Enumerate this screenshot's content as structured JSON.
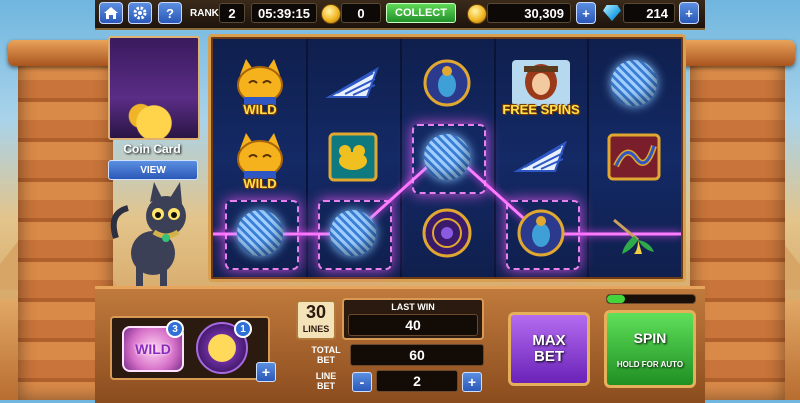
{
  "topbar": {
    "rank_label": "RANK",
    "rank_value": "2",
    "timer": "05:39:15",
    "collect_coins": "0",
    "collect_label": "COLLECT",
    "coin_balance": "30,309",
    "gem_balance": "214",
    "home_icon": "home-icon",
    "settings_icon": "gear-icon",
    "help_label": "?",
    "add_label": "+"
  },
  "coin_card": {
    "title": "Coin Card",
    "view_label": "VIEW"
  },
  "reels": {
    "rows": [
      [
        {
          "sym": "cat",
          "label": "WILD"
        },
        {
          "sym": "pyramid",
          "label": ""
        },
        {
          "sym": "scarab",
          "label": ""
        },
        {
          "sym": "explorer",
          "label": "FREE SPINS"
        },
        {
          "sym": "yarn",
          "label": ""
        }
      ],
      [
        {
          "sym": "cat",
          "label": "WILD"
        },
        {
          "sym": "mouse",
          "label": ""
        },
        {
          "sym": "yarn",
          "label": ""
        },
        {
          "sym": "pyramid",
          "label": ""
        },
        {
          "sym": "snake",
          "label": ""
        }
      ],
      [
        {
          "sym": "yarn",
          "label": ""
        },
        {
          "sym": "yarn",
          "label": ""
        },
        {
          "sym": "amulet",
          "label": ""
        },
        {
          "sym": "scarab",
          "label": ""
        },
        {
          "sym": "lotus",
          "label": ""
        }
      ]
    ]
  },
  "boosters": {
    "wild_label": "WILD",
    "wild_count": "3",
    "coins_count": "1",
    "add_label": "+"
  },
  "bet": {
    "lines_value": "30",
    "lines_label": "LINES",
    "last_win_label": "LAST WIN",
    "last_win_value": "40",
    "total_bet_label": "TOTAL\nBET",
    "total_bet_value": "60",
    "line_bet_label": "LINE\nBET",
    "line_bet_value": "2",
    "minus_label": "-",
    "plus_label": "+"
  },
  "buttons": {
    "max_bet_label": "MAX\nBET",
    "spin_label": "SPIN",
    "spin_sub": "HOLD FOR AUTO"
  },
  "colors": {
    "accent_purple": "#8a2be2",
    "spin_green": "#2fae2a",
    "collect_green": "#3fbf3a",
    "win_line": "#ff7bff"
  }
}
